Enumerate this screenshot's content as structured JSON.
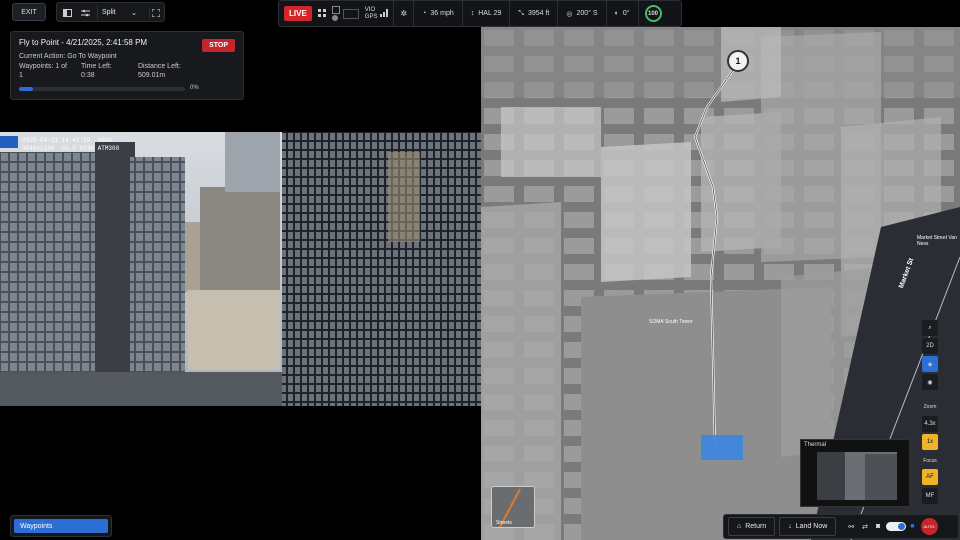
{
  "toolbar": {
    "exit_label": "EXIT",
    "view_mode": "Split"
  },
  "status_bar": {
    "live_label": "LIVE",
    "vio_label": "VIO",
    "gps_label": "GPS",
    "speed": "36 mph",
    "hal": "HAL 29",
    "distance": "3954 ft",
    "heading": "200° S",
    "gimbal": "0°",
    "battery": "100"
  },
  "mission": {
    "title": "Fly to Point - 4/21/2025, 2:41:58 PM",
    "stop_label": "STOP",
    "current_action": "Current Action: Go To Waypoint",
    "waypoints_label": "Waypoints: 1 of",
    "waypoints_value": "1",
    "time_left_label": "Time Left:",
    "time_left_value": "0:38",
    "distance_left_label": "Distance Left:",
    "distance_left_value": "509.01m",
    "progress_text": "0%",
    "progress_fraction": 0.0
  },
  "map": {
    "waypoint_number": "1",
    "street_label": "Market St",
    "poi_1": "SOMA South Tower",
    "poi_2": "Market Street Van Ness",
    "basemap_label": "Streets",
    "thermal_label": "Thermal"
  },
  "map_controls": {
    "view_2d": "2D",
    "zoom_label": "Zoom",
    "zoom_value": "4.3x",
    "zoom_1x": "1x",
    "focus_label": "Focus",
    "focus_af": "AF",
    "focus_mf": "MF"
  },
  "bottom": {
    "waypoints_button": "Waypoints",
    "return_label": "Return",
    "land_label": "Land Now",
    "auto_label": "AUTO"
  },
  "colors": {
    "accent_blue": "#2b6fd6",
    "live_red": "#d2262b",
    "stop_red": "#c5262b",
    "highlight_yellow": "#f0b428"
  }
}
